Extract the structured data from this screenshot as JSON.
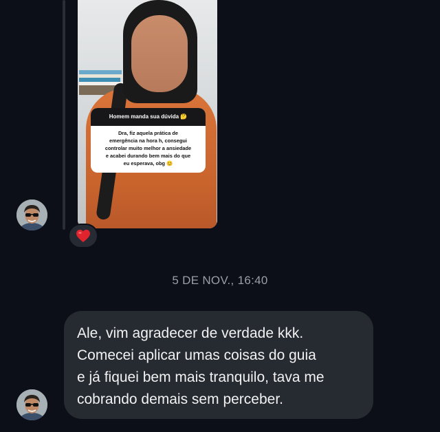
{
  "conversation": {
    "story_reply": {
      "question_header": "Homem manda sua dúvida 🤔",
      "question_lines": [
        "Dra, fiz aquela prática de",
        "emergência na hora h, consegui",
        "controlar muito melhor a ansiedade",
        "e acabei durando bem mais do que",
        "eu esperava, obg 😊"
      ],
      "reaction_emoji": "❤️",
      "reaction_icon": "heart-icon"
    },
    "timestamp": "5 DE NOV., 16:40",
    "message": {
      "lines": [
        "Ale, vim agradecer de verdade kkk.",
        "Comecei aplicar umas coisas do guia",
        "e já fiquei bem mais tranquilo, tava me",
        "cobrando demais sem perceber."
      ]
    }
  },
  "colors": {
    "background": "#0c0f17",
    "bubble": "#262a31",
    "timestamp": "#9a9fa8",
    "reaction_heart": "#e0242e"
  }
}
